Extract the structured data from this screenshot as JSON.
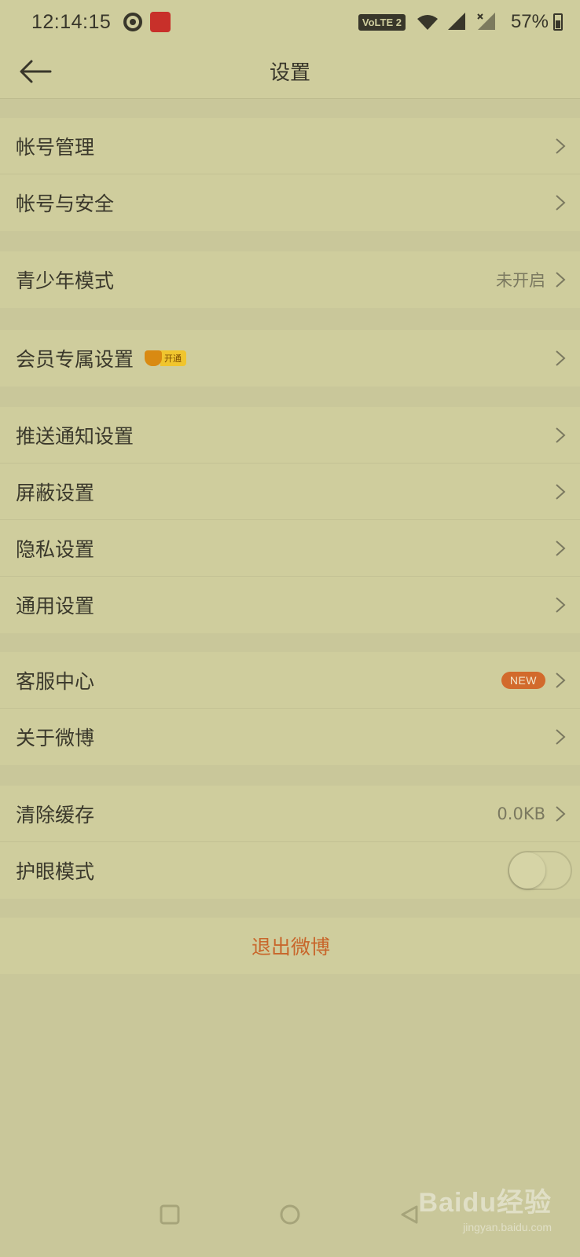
{
  "status_bar": {
    "time": "12:14:15",
    "network_badge": "VoLTE 2",
    "battery": "57%"
  },
  "header": {
    "title": "设置",
    "back_icon": "arrow-left-icon"
  },
  "groups": [
    {
      "items": [
        {
          "label": "帐号管理"
        },
        {
          "label": "帐号与安全"
        }
      ]
    },
    {
      "items": [
        {
          "label": "青少年模式",
          "value": "未开启"
        }
      ]
    },
    {
      "items": [
        {
          "label": "会员专属设置",
          "badge": "开通"
        }
      ]
    },
    {
      "items": [
        {
          "label": "推送通知设置"
        },
        {
          "label": "屏蔽设置"
        },
        {
          "label": "隐私设置"
        },
        {
          "label": "通用设置"
        }
      ]
    },
    {
      "items": [
        {
          "label": "客服中心",
          "badge": "NEW"
        },
        {
          "label": "关于微博"
        }
      ]
    },
    {
      "items": [
        {
          "label": "清除缓存",
          "value": "0.0KB"
        },
        {
          "label": "护眼模式",
          "toggle": false
        }
      ]
    }
  ],
  "logout": {
    "label": "退出微博"
  },
  "colors": {
    "background": "#c9c79a",
    "row_background": "#cfcd9d",
    "accent": "#c8662b",
    "new_badge": "#d26a2c"
  },
  "watermark": {
    "logo": "Baidu经验",
    "url": "jingyan.baidu.com"
  }
}
